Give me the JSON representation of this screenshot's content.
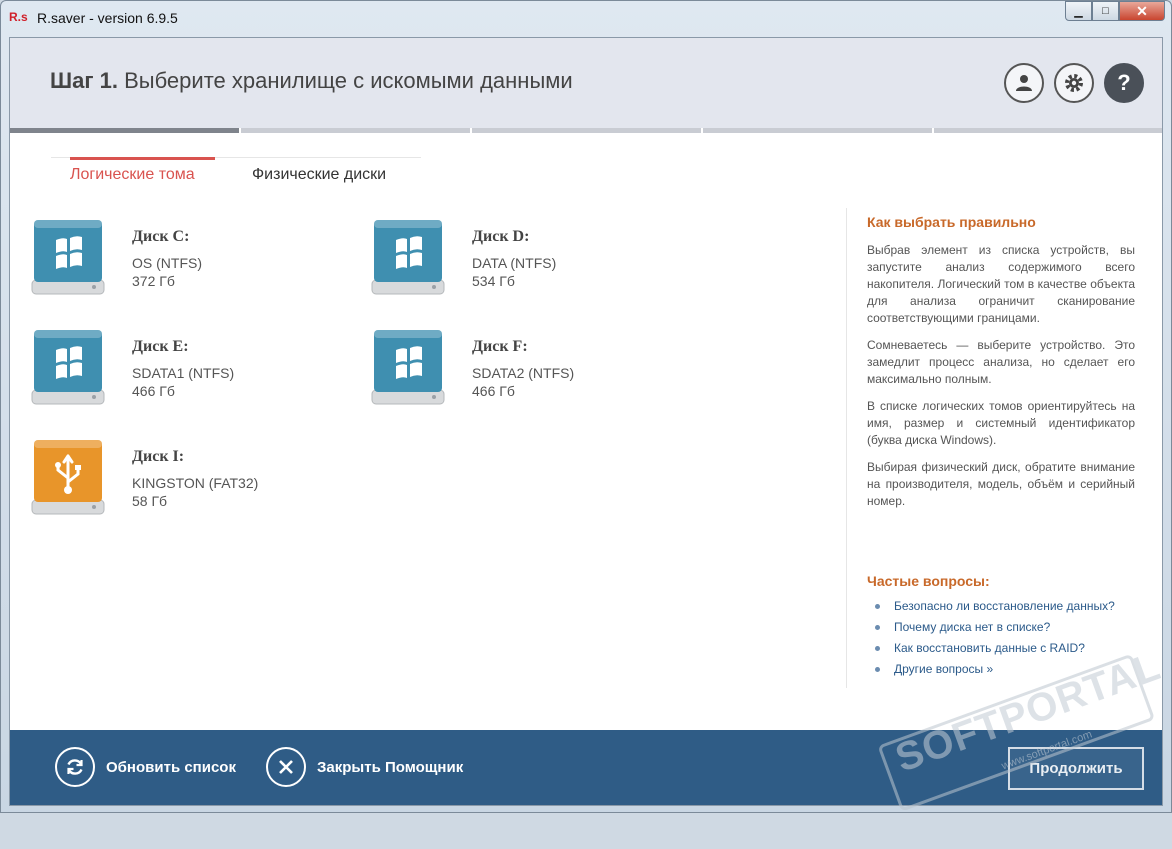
{
  "window": {
    "app_logo": "R.s",
    "title": "R.saver - version 6.9.5",
    "min_label": "▁",
    "max_label": "□",
    "close_label": "✕"
  },
  "header": {
    "step_number": "Шаг 1.",
    "step_text": "Выберите хранилище с искомыми данными",
    "help_label": "?",
    "progress_fraction": 0.2
  },
  "tabs": [
    {
      "label": "Логические тома",
      "active": true
    },
    {
      "label": "Физические диски",
      "active": false
    }
  ],
  "disks": [
    {
      "name": "Диск C:",
      "fs": "OS (NTFS)",
      "size": "372 Гб",
      "icon": "windows-drive-icon",
      "color": "#3f8fb0"
    },
    {
      "name": "Диск D:",
      "fs": "DATA (NTFS)",
      "size": "534 Гб",
      "icon": "windows-drive-icon",
      "color": "#3f8fb0"
    },
    {
      "name": "Диск E:",
      "fs": "SDATA1 (NTFS)",
      "size": "466 Гб",
      "icon": "windows-drive-icon",
      "color": "#3f8fb0"
    },
    {
      "name": "Диск F:",
      "fs": "SDATA2 (NTFS)",
      "size": "466 Гб",
      "icon": "windows-drive-icon",
      "color": "#3f8fb0"
    },
    {
      "name": "Диск I:",
      "fs": "KINGSTON (FAT32)",
      "size": "58 Гб",
      "icon": "usb-drive-icon",
      "color": "#e8952a"
    }
  ],
  "sidebar": {
    "heading": "Как выбрать правильно",
    "paragraphs": [
      "Выбрав элемент из списка устройств, вы запустите анализ содержимого всего накопителя. Логический том в качестве объекта для анализа ограничит сканирование соответствующими границами.",
      "Сомневаетесь — выберите устройство. Это замедлит процесс анализа, но сделает его максимально полным.",
      "В списке логических томов ориентируйтесь на имя, размер и системный идентификатор (буква диска Windows).",
      "Выбирая физический диск, обратите внимание на производителя, модель, объём и серийный номер."
    ]
  },
  "faq": {
    "heading": "Частые вопросы:",
    "items": [
      "Безопасно ли восстановление данных?",
      "Почему диска нет в списке?",
      "Как восстановить данные с RAID?",
      "Другие вопросы »"
    ]
  },
  "footer": {
    "refresh_label": "Обновить список",
    "close_label": "Закрыть Помощник",
    "continue_label": "Продолжить"
  },
  "watermark": {
    "text": "SOFTPORTAL",
    "url": "www.softportal.com"
  },
  "colors": {
    "accent": "#d9534f",
    "footer": "#2f5c86",
    "sidebar_heading": "#c8692a",
    "link": "#2b5a8a"
  }
}
